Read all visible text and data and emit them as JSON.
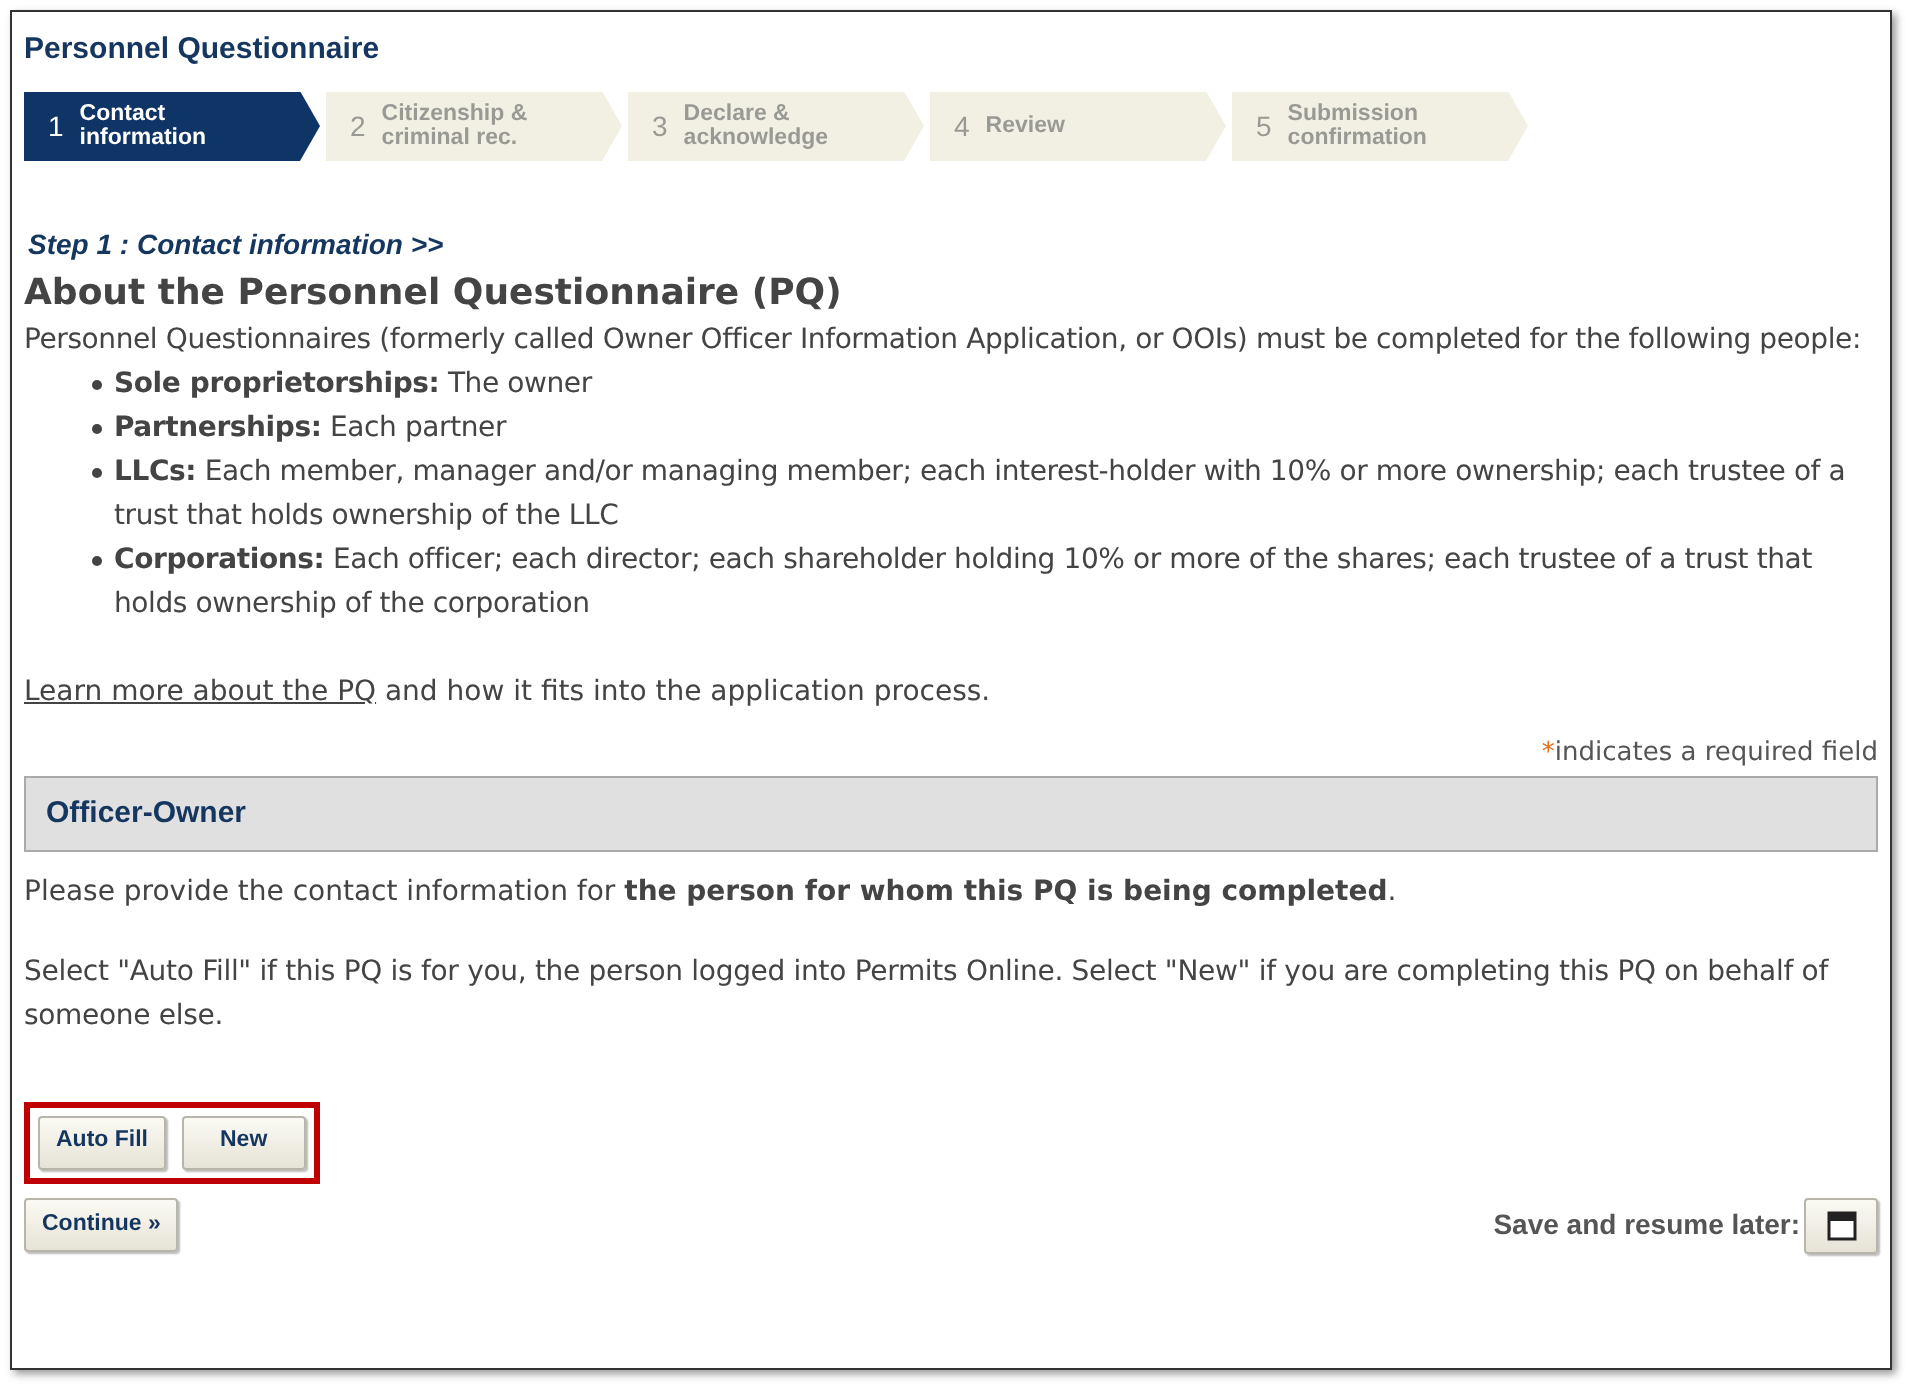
{
  "title": "Personnel Questionnaire",
  "steps": [
    {
      "number": "1",
      "label": "Contact information",
      "selected": true
    },
    {
      "number": "2",
      "label": "Citizenship & criminal rec.",
      "selected": false
    },
    {
      "number": "3",
      "label": "Declare & acknowledge",
      "selected": false
    },
    {
      "number": "4",
      "label": "Review",
      "selected": false
    },
    {
      "number": "5",
      "label": "Submission confirmation",
      "selected": false
    }
  ],
  "breadcrumb": "Step 1 : Contact information >>",
  "heading": "About the Personnel Questionnaire (PQ)",
  "intro": "Personnel Questionnaires (formerly called Owner Officer Information Application, or OOIs) must be completed for the following people:",
  "bullets": [
    "**Sole proprietorships:** The owner",
    "**Partnerships:** Each partner",
    "**LLCs:** Each member, manager and/or managing member; each interest-holder with 10% or more ownership; each trustee of a trust that holds ownership of the LLC",
    "**Corporations:** Each officer; each director; each shareholder holding 10% or more of the shares; each trustee of a trust that holds ownership of the corporation"
  ],
  "learn_more": {
    "link": "Learn more about the PQ",
    "text": " and how it fits into the application process."
  },
  "required_note": {
    "mark": "*",
    "text": "indicates a required field"
  },
  "section_title": "Officer-Owner",
  "instruction": "Please provide the contact information for **the person for whom this PQ is being completed**.",
  "auto_fill_note": "Select \"Auto Fill\" if this PQ is for you, the person logged into Permits Online.  Select \"New\" if you are completing this PQ on behalf of someone else.",
  "choice_buttons": {
    "highlighted": true,
    "labels": [
      "Auto Fill",
      "New"
    ]
  },
  "continue_button": "Continue »",
  "save_label": "Save and resume later:"
}
